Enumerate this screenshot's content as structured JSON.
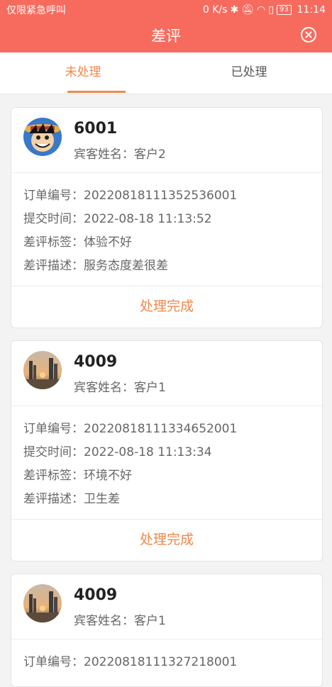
{
  "status_bar": {
    "carrier": "仅限紧急呼叫",
    "speed": "0 K/s",
    "battery": "93",
    "time": "11:14"
  },
  "header": {
    "title": "差评"
  },
  "tabs": [
    {
      "label": "未处理",
      "active": true
    },
    {
      "label": "已处理",
      "active": false
    }
  ],
  "cards": [
    {
      "id": "6001",
      "guest_label": "宾客姓名：",
      "guest_name": "客户2",
      "order_label": "订单编号：",
      "order_no": "20220818111352536001",
      "time_label": "提交时间：",
      "time": "2022-08-18 11:13:52",
      "tag_label": "差评标签：",
      "tag": "体验不好",
      "desc_label": "差评描述：",
      "desc": "服务态度差很差",
      "action": "处理完成"
    },
    {
      "id": "4009",
      "guest_label": "宾客姓名：",
      "guest_name": "客户1",
      "order_label": "订单编号：",
      "order_no": "20220818111334652001",
      "time_label": "提交时间：",
      "time": "2022-08-18 11:13:34",
      "tag_label": "差评标签：",
      "tag": "环境不好",
      "desc_label": "差评描述：",
      "desc": "卫生差",
      "action": "处理完成"
    },
    {
      "id": "4009",
      "guest_label": "宾客姓名：",
      "guest_name": "客户1",
      "order_label": "订单编号：",
      "order_no": "20220818111327218001"
    }
  ],
  "colors": {
    "header_bg": "#f76b5e",
    "accent": "#f2874a"
  }
}
